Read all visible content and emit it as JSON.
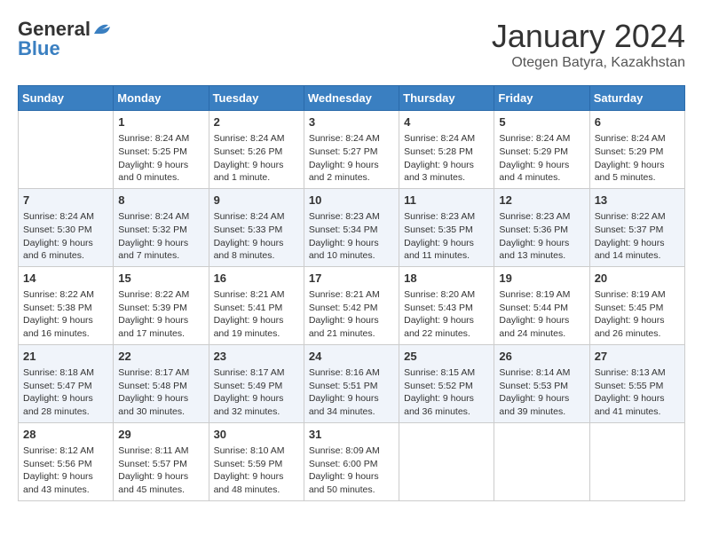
{
  "header": {
    "logo_line1": "General",
    "logo_line2": "Blue",
    "month": "January 2024",
    "location": "Otegen Batyra, Kazakhstan"
  },
  "days_of_week": [
    "Sunday",
    "Monday",
    "Tuesday",
    "Wednesday",
    "Thursday",
    "Friday",
    "Saturday"
  ],
  "weeks": [
    [
      {
        "day": "",
        "info": ""
      },
      {
        "day": "1",
        "info": "Sunrise: 8:24 AM\nSunset: 5:25 PM\nDaylight: 9 hours\nand 0 minutes."
      },
      {
        "day": "2",
        "info": "Sunrise: 8:24 AM\nSunset: 5:26 PM\nDaylight: 9 hours\nand 1 minute."
      },
      {
        "day": "3",
        "info": "Sunrise: 8:24 AM\nSunset: 5:27 PM\nDaylight: 9 hours\nand 2 minutes."
      },
      {
        "day": "4",
        "info": "Sunrise: 8:24 AM\nSunset: 5:28 PM\nDaylight: 9 hours\nand 3 minutes."
      },
      {
        "day": "5",
        "info": "Sunrise: 8:24 AM\nSunset: 5:29 PM\nDaylight: 9 hours\nand 4 minutes."
      },
      {
        "day": "6",
        "info": "Sunrise: 8:24 AM\nSunset: 5:29 PM\nDaylight: 9 hours\nand 5 minutes."
      }
    ],
    [
      {
        "day": "7",
        "info": "Sunrise: 8:24 AM\nSunset: 5:30 PM\nDaylight: 9 hours\nand 6 minutes."
      },
      {
        "day": "8",
        "info": "Sunrise: 8:24 AM\nSunset: 5:32 PM\nDaylight: 9 hours\nand 7 minutes."
      },
      {
        "day": "9",
        "info": "Sunrise: 8:24 AM\nSunset: 5:33 PM\nDaylight: 9 hours\nand 8 minutes."
      },
      {
        "day": "10",
        "info": "Sunrise: 8:23 AM\nSunset: 5:34 PM\nDaylight: 9 hours\nand 10 minutes."
      },
      {
        "day": "11",
        "info": "Sunrise: 8:23 AM\nSunset: 5:35 PM\nDaylight: 9 hours\nand 11 minutes."
      },
      {
        "day": "12",
        "info": "Sunrise: 8:23 AM\nSunset: 5:36 PM\nDaylight: 9 hours\nand 13 minutes."
      },
      {
        "day": "13",
        "info": "Sunrise: 8:22 AM\nSunset: 5:37 PM\nDaylight: 9 hours\nand 14 minutes."
      }
    ],
    [
      {
        "day": "14",
        "info": "Sunrise: 8:22 AM\nSunset: 5:38 PM\nDaylight: 9 hours\nand 16 minutes."
      },
      {
        "day": "15",
        "info": "Sunrise: 8:22 AM\nSunset: 5:39 PM\nDaylight: 9 hours\nand 17 minutes."
      },
      {
        "day": "16",
        "info": "Sunrise: 8:21 AM\nSunset: 5:41 PM\nDaylight: 9 hours\nand 19 minutes."
      },
      {
        "day": "17",
        "info": "Sunrise: 8:21 AM\nSunset: 5:42 PM\nDaylight: 9 hours\nand 21 minutes."
      },
      {
        "day": "18",
        "info": "Sunrise: 8:20 AM\nSunset: 5:43 PM\nDaylight: 9 hours\nand 22 minutes."
      },
      {
        "day": "19",
        "info": "Sunrise: 8:19 AM\nSunset: 5:44 PM\nDaylight: 9 hours\nand 24 minutes."
      },
      {
        "day": "20",
        "info": "Sunrise: 8:19 AM\nSunset: 5:45 PM\nDaylight: 9 hours\nand 26 minutes."
      }
    ],
    [
      {
        "day": "21",
        "info": "Sunrise: 8:18 AM\nSunset: 5:47 PM\nDaylight: 9 hours\nand 28 minutes."
      },
      {
        "day": "22",
        "info": "Sunrise: 8:17 AM\nSunset: 5:48 PM\nDaylight: 9 hours\nand 30 minutes."
      },
      {
        "day": "23",
        "info": "Sunrise: 8:17 AM\nSunset: 5:49 PM\nDaylight: 9 hours\nand 32 minutes."
      },
      {
        "day": "24",
        "info": "Sunrise: 8:16 AM\nSunset: 5:51 PM\nDaylight: 9 hours\nand 34 minutes."
      },
      {
        "day": "25",
        "info": "Sunrise: 8:15 AM\nSunset: 5:52 PM\nDaylight: 9 hours\nand 36 minutes."
      },
      {
        "day": "26",
        "info": "Sunrise: 8:14 AM\nSunset: 5:53 PM\nDaylight: 9 hours\nand 39 minutes."
      },
      {
        "day": "27",
        "info": "Sunrise: 8:13 AM\nSunset: 5:55 PM\nDaylight: 9 hours\nand 41 minutes."
      }
    ],
    [
      {
        "day": "28",
        "info": "Sunrise: 8:12 AM\nSunset: 5:56 PM\nDaylight: 9 hours\nand 43 minutes."
      },
      {
        "day": "29",
        "info": "Sunrise: 8:11 AM\nSunset: 5:57 PM\nDaylight: 9 hours\nand 45 minutes."
      },
      {
        "day": "30",
        "info": "Sunrise: 8:10 AM\nSunset: 5:59 PM\nDaylight: 9 hours\nand 48 minutes."
      },
      {
        "day": "31",
        "info": "Sunrise: 8:09 AM\nSunset: 6:00 PM\nDaylight: 9 hours\nand 50 minutes."
      },
      {
        "day": "",
        "info": ""
      },
      {
        "day": "",
        "info": ""
      },
      {
        "day": "",
        "info": ""
      }
    ]
  ]
}
